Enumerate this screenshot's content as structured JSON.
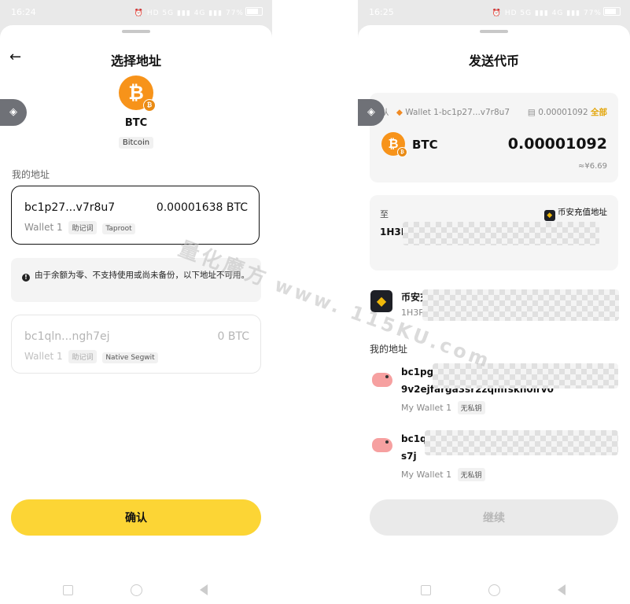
{
  "left": {
    "status": {
      "time": "16:24",
      "battery": "77%"
    },
    "title": "选择地址",
    "coin": {
      "symbol": "BTC",
      "name": "Bitcoin"
    },
    "section_label": "我的地址",
    "selected_address": {
      "address": "bc1p27...v7r8u7",
      "amount": "0.00001638 BTC",
      "wallet": "Wallet 1",
      "tag1": "助记词",
      "tag2": "Taproot"
    },
    "notice": "由于余额为零、不支持使用或尚未备份，以下地址不可用。",
    "disabled_address": {
      "address": "bc1qln...ngh7ej",
      "amount": "0 BTC",
      "wallet": "Wallet 1",
      "tag1": "助记词",
      "tag2": "Native Segwit"
    },
    "confirm_label": "确认"
  },
  "right": {
    "status": {
      "time": "16:25",
      "battery": "77%"
    },
    "title": "发送代币",
    "from": {
      "label": "从",
      "wallet": "Wallet 1-bc1p27...v7r8u7",
      "balance": "0.00001092",
      "all_label": "全部",
      "symbol": "BTC",
      "amount": "0.00001092",
      "fiat": "≈¥6.69"
    },
    "to": {
      "label": "至",
      "exchange_label": "币安充值地址",
      "address_prefix": "1H3P"
    },
    "exchange_item": {
      "label": "币安充值地址",
      "address_prefix": "1H3P"
    },
    "my_address_label": "我的地址",
    "my_addresses": [
      {
        "line1": "bc1pgg",
        "line2": "9v2ejfarga3sr2zqmfskn0lrv0",
        "wallet": "My Wallet 1",
        "tag": "无私钥"
      },
      {
        "line1": "bc1q",
        "line2": "s7j",
        "wallet": "My Wallet 1",
        "tag": "无私钥"
      }
    ],
    "continue_label": "继续"
  },
  "watermark": {
    "line1": "量化魔方",
    "line2": "www. 115KU.com"
  }
}
